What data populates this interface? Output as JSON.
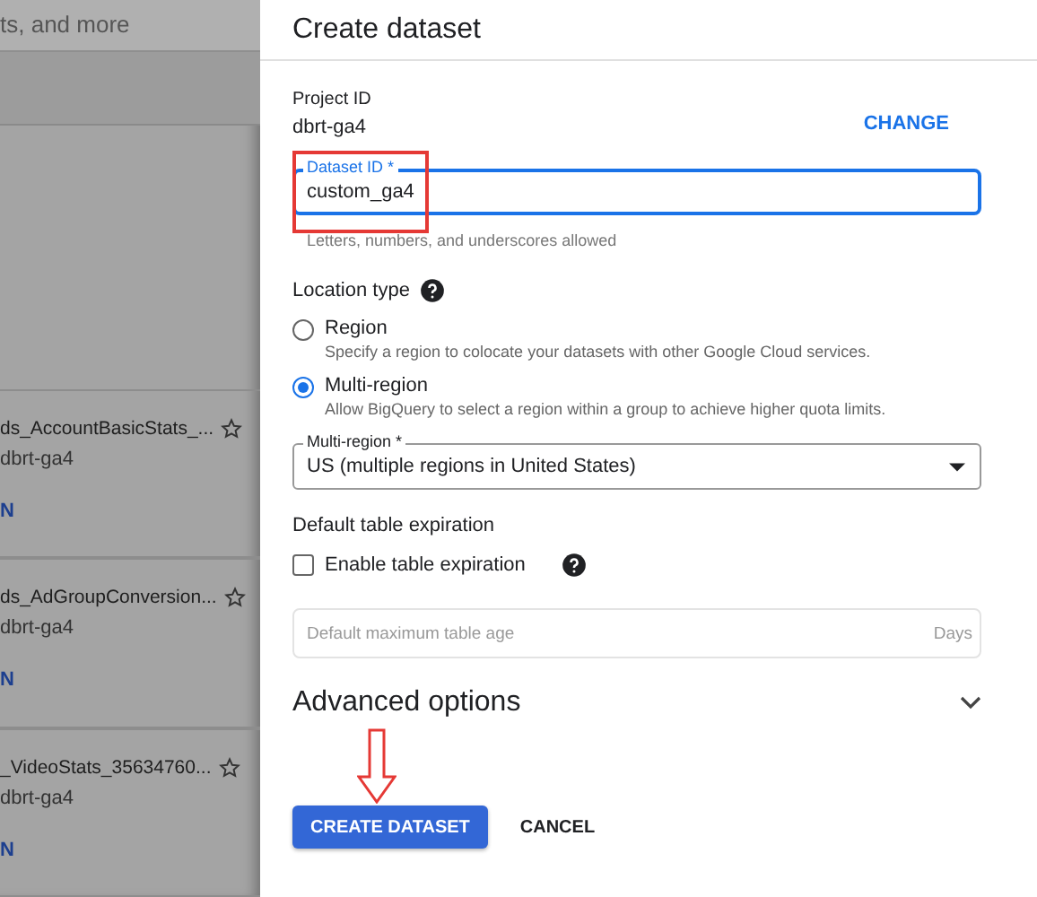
{
  "background": {
    "search_placeholder": "ts, and more",
    "cards": [
      {
        "title": "ds_AccountBasicStats_...",
        "project": "dbrt-ga4",
        "link": "N",
        "starred": false
      },
      {
        "title": "ds_AdGroupConversion...",
        "project": "dbrt-ga4",
        "link": "N",
        "starred": false
      },
      {
        "title": "_VideoStats_35634760...",
        "project": "dbrt-ga4",
        "link": "N",
        "starred": false
      }
    ]
  },
  "panel": {
    "title": "Create dataset",
    "project_label": "Project ID",
    "project_value": "dbrt-ga4",
    "change_button": "CHANGE",
    "dataset_field": {
      "label": "Dataset ID *",
      "value": "custom_ga4",
      "helper": "Letters, numbers, and underscores allowed"
    },
    "location_heading": "Location type",
    "location_options": [
      {
        "label": "Region",
        "description": "Specify a region to colocate your datasets with other Google Cloud services.",
        "selected": false
      },
      {
        "label": "Multi-region",
        "description": "Allow BigQuery to select a region within a group to achieve higher quota limits.",
        "selected": true
      }
    ],
    "multi_region_select": {
      "label": "Multi-region *",
      "value": "US (multiple regions in United States)"
    },
    "expiration_heading": "Default table expiration",
    "expiration_checkbox": {
      "label": "Enable table expiration",
      "checked": false
    },
    "max_age_field": {
      "placeholder": "Default maximum table age",
      "suffix": "Days",
      "disabled": true
    },
    "advanced": {
      "label": "Advanced options",
      "expanded": false
    },
    "buttons": [
      {
        "label": "CREATE DATASET",
        "kind": "primary"
      },
      {
        "label": "CANCEL",
        "kind": "text"
      }
    ]
  }
}
